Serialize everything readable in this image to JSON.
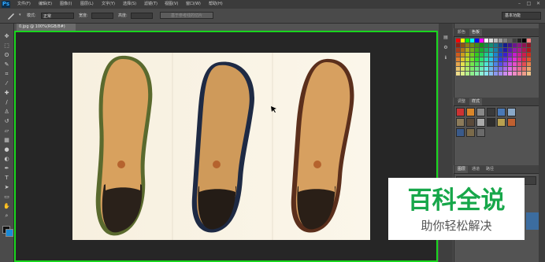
{
  "app": {
    "logo": "Ps"
  },
  "menu": [
    "文件(F)",
    "编辑(E)",
    "图像(I)",
    "图层(L)",
    "文字(Y)",
    "选择(S)",
    "滤镜(T)",
    "视图(V)",
    "窗口(W)",
    "帮助(H)"
  ],
  "window_controls": {
    "minimize": "–",
    "maximize": "□",
    "close": "✕"
  },
  "options": {
    "mode_label": "模式:",
    "mode_value": "正常",
    "width_label": "宽度:",
    "height_label": "高度:",
    "refine_button": "基于参考线的切片"
  },
  "workspace": "基本功能",
  "document_tab": "0.jpg @ 100%(RGB/8#)",
  "panels": {
    "top_tabs": [
      "颜色",
      "色板"
    ],
    "mid_tabs": [
      "调整",
      "样式"
    ],
    "bottom_tabs": [
      "图层",
      "通道",
      "路径"
    ]
  },
  "tools": [
    "move-tool",
    "marquee-tool",
    "lasso-tool",
    "quick-select-tool",
    "crop-tool",
    "eyedropper-tool",
    "healing-brush-tool",
    "brush-tool",
    "clone-stamp-tool",
    "history-brush-tool",
    "eraser-tool",
    "gradient-tool",
    "blur-tool",
    "dodge-tool",
    "pen-tool",
    "type-tool",
    "path-select-tool",
    "shape-tool",
    "hand-tool",
    "zoom-tool"
  ],
  "watermark": {
    "title": "百科全说",
    "subtitle": "助你轻松解决"
  },
  "colors": {
    "accent_green": "#19d61e",
    "watermark_green": "#17a74a"
  }
}
